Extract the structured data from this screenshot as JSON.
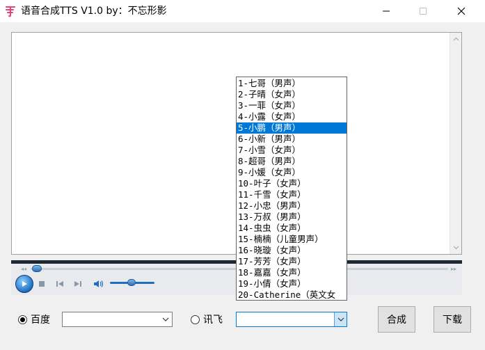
{
  "window": {
    "title": "语音合成TTS V1.0 by：不忘形影",
    "min_glyph": "—",
    "max_glyph": "☐",
    "close_glyph": "✕"
  },
  "player": {
    "seek_progress": 0.0,
    "volume_level": 0.5
  },
  "engines": {
    "baidu_label": "百度",
    "baidu_selected": true,
    "baidu_voice_value": "",
    "xunfei_label": "讯飞",
    "xunfei_selected": false,
    "xunfei_voice_value": ""
  },
  "voice_dropdown": {
    "selected_index": 4,
    "options": [
      "1-七哥（男声）",
      "2-子晴（女声）",
      "3-一菲（女声）",
      "4-小露（女声）",
      "5-小鹏（男声）",
      "6-小新（男声）",
      "7-小雪（女声）",
      "8-超哥（男声）",
      "9-小媛（女声）",
      "10-叶子（女声）",
      "11-千雪（女声）",
      "12-小忠（男声）",
      "13-万叔（男声）",
      "14-虫虫（女声）",
      "15-楠楠（儿童男声）",
      "16-晓璇（女声）",
      "17-芳芳（女声）",
      "18-嘉嘉（女声）",
      "19-小倩（女声）",
      "20-Catherine（英文女"
    ]
  },
  "buttons": {
    "synthesize": "合成",
    "download": "下载"
  },
  "colors": {
    "accent": "#0078d7",
    "app_icon": "#e0457b"
  }
}
